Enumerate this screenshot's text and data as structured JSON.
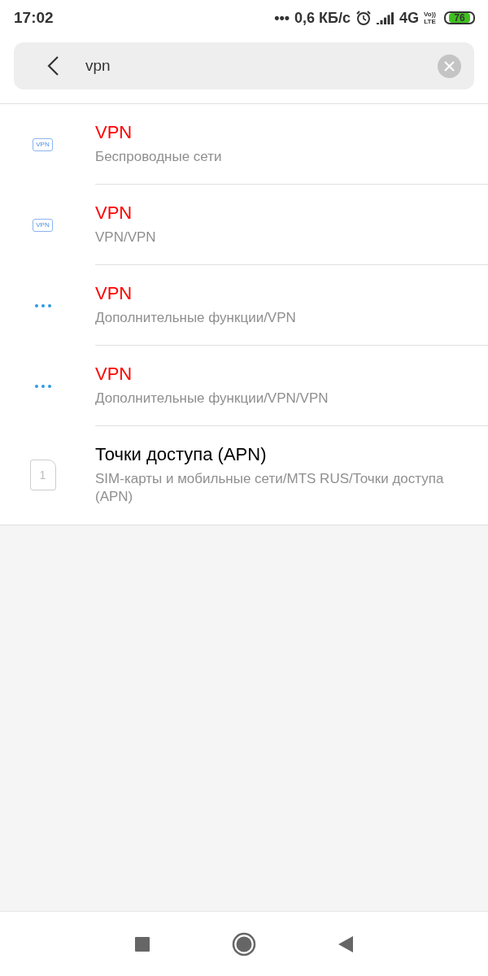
{
  "status_bar": {
    "time": "17:02",
    "dots": "•••",
    "speed": "0,6 КБ/с",
    "network": "4G",
    "volte_top": "Vo))",
    "volte_bottom": "LTE",
    "battery": "76"
  },
  "search": {
    "value": "vpn"
  },
  "results": [
    {
      "kind": "vpn",
      "icon_text": "VPN",
      "title": "VPN",
      "highlighted": true,
      "path": "Беспроводные сети"
    },
    {
      "kind": "vpn",
      "icon_text": "VPN",
      "title": "VPN",
      "highlighted": true,
      "path": "VPN/VPN"
    },
    {
      "kind": "more",
      "title": "VPN",
      "highlighted": true,
      "path": "Дополнительные функции/VPN"
    },
    {
      "kind": "more",
      "title": "VPN",
      "highlighted": true,
      "path": "Дополнительные функции/VPN/VPN"
    },
    {
      "kind": "sim",
      "icon_text": "1",
      "title": "Точки доступа (APN)",
      "highlighted": false,
      "path": "SIM-карты и мобильные сети/MTS RUS/Точки доступа (APN)"
    }
  ]
}
